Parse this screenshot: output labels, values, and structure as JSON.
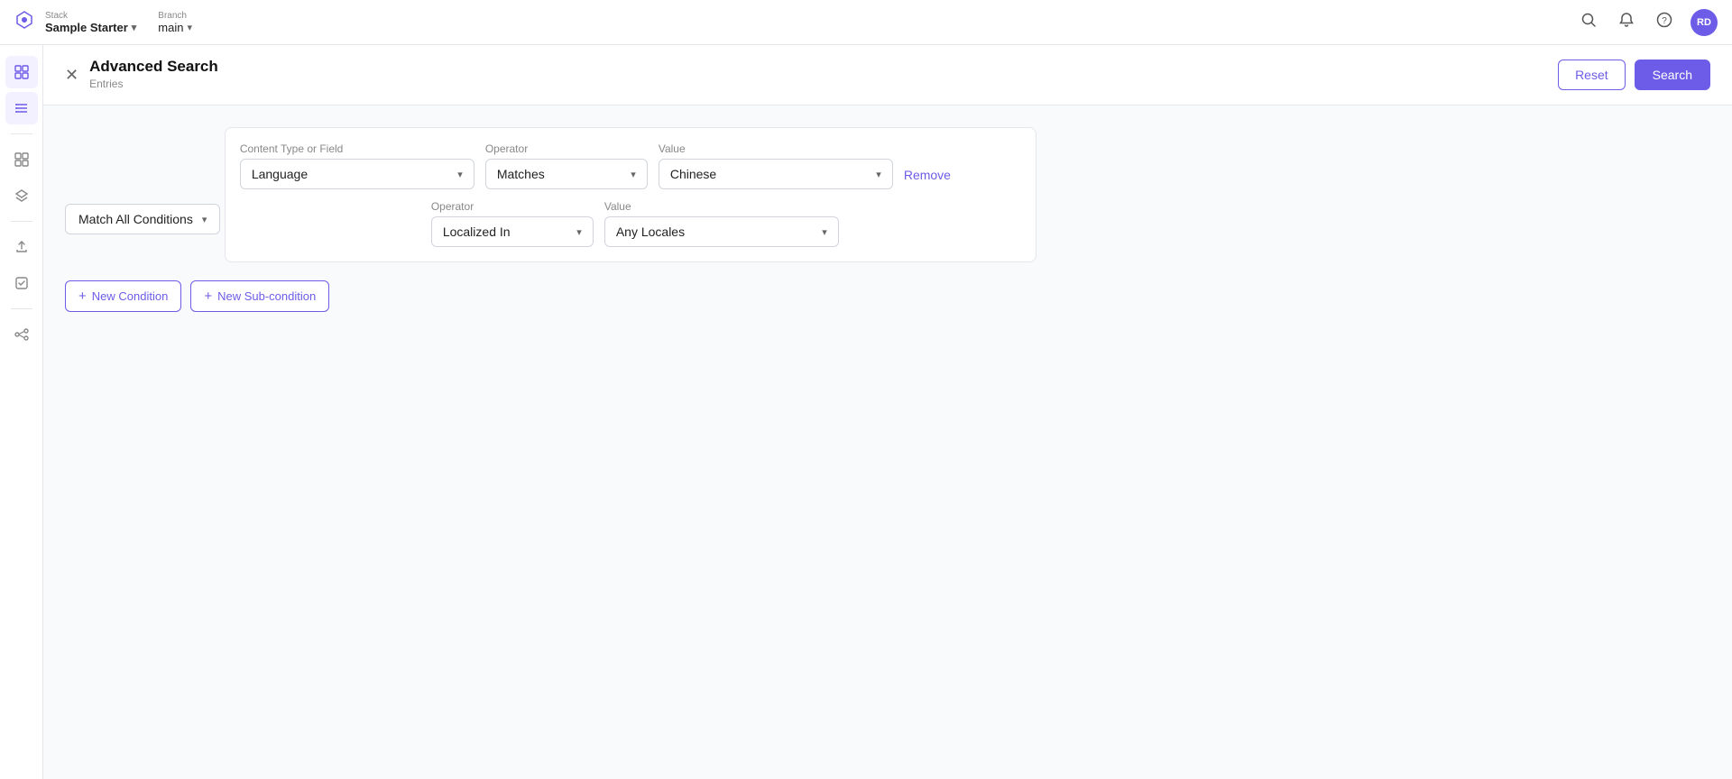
{
  "topbar": {
    "logo_symbol": "◈",
    "stack_label": "Stack",
    "stack_name": "Sample Starter",
    "branch_label": "Branch",
    "branch_name": "main",
    "search_icon": "🔍",
    "bell_icon": "🔔",
    "help_icon": "❓",
    "avatar_initials": "RD"
  },
  "sidebar": {
    "items": [
      {
        "name": "grid-icon",
        "symbol": "⊞"
      },
      {
        "name": "list-icon",
        "symbol": "≡"
      },
      {
        "name": "filter-icon",
        "symbol": "⊟"
      },
      {
        "name": "layers-icon",
        "symbol": "⧉"
      },
      {
        "name": "upload-icon",
        "symbol": "⬆"
      },
      {
        "name": "task-icon",
        "symbol": "☑"
      },
      {
        "name": "workflow-icon",
        "symbol": "⊕"
      }
    ]
  },
  "page_header": {
    "title": "Advanced Search",
    "subtitle": "Entries",
    "reset_label": "Reset",
    "search_label": "Search"
  },
  "search": {
    "match_all_label": "Match All Conditions",
    "condition1": {
      "content_type_label": "Content Type or Field",
      "content_type_value": "Language",
      "operator_label": "Operator",
      "operator_value": "Matches",
      "value_label": "Value",
      "value_value": "Chinese",
      "remove_label": "Remove"
    },
    "sub_condition1": {
      "operator_label": "Operator",
      "operator_value": "Localized In",
      "value_label": "Value",
      "value_value": "Any Locales"
    },
    "new_condition_label": "New Condition",
    "new_sub_condition_label": "New Sub-condition"
  }
}
